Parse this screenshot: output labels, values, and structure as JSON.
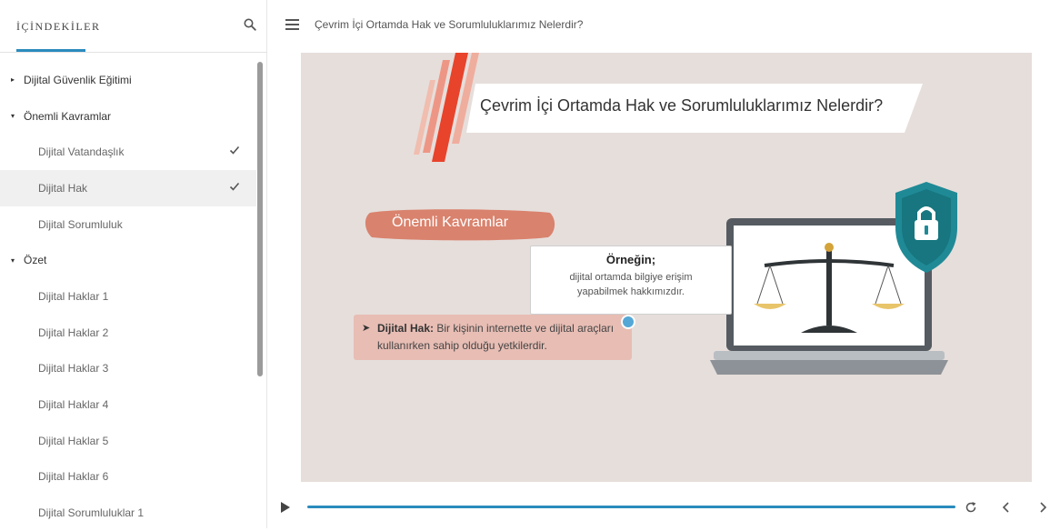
{
  "sidebar": {
    "title": "İÇİNDEKİLER",
    "search_icon": "search-icon",
    "items": [
      {
        "label": "Dijital Güvenlik Eğitimi",
        "type": "section",
        "expanded": false
      },
      {
        "label": "Önemli Kavramlar",
        "type": "section",
        "expanded": true
      },
      {
        "label": "Dijital Vatandaşlık",
        "type": "child",
        "completed": true
      },
      {
        "label": "Dijital Hak",
        "type": "child",
        "completed": true,
        "active": true
      },
      {
        "label": "Dijital Sorumluluk",
        "type": "child"
      },
      {
        "label": "Özet",
        "type": "section",
        "expanded": true
      },
      {
        "label": "Dijital Haklar 1",
        "type": "child"
      },
      {
        "label": "Dijital Haklar 2",
        "type": "child"
      },
      {
        "label": "Dijital Haklar 3",
        "type": "child"
      },
      {
        "label": "Dijital Haklar 4",
        "type": "child"
      },
      {
        "label": "Dijital Haklar 5",
        "type": "child"
      },
      {
        "label": "Dijital Haklar 6",
        "type": "child"
      },
      {
        "label": "Dijital Sorumluluklar 1",
        "type": "child"
      }
    ]
  },
  "header": {
    "title": "Çevrim İçi Ortamda Hak ve Sorumluluklarımız Nelerdir?"
  },
  "slide": {
    "banner_title": "Çevrim İçi Ortamda Hak ve Sorumluluklarımız Nelerdir?",
    "pill_label": "Önemli Kavramlar",
    "example_title": "Örneğin;",
    "example_body": "dijital ortamda bilgiye erişim yapabilmek hakkımızdır.",
    "definition_term": "Dijital Hak:",
    "definition_text": " Bir kişinin internette ve dijital araçları kullanırken sahip olduğu yetkilerdir.",
    "illustration": "laptop-scales-lock-icon"
  },
  "colors": {
    "accent": "#2a8bbd",
    "slide_bg": "#e6dedb",
    "pill": "#d9826d",
    "shield": "#1f8a96"
  },
  "player": {
    "progress": 1.0
  }
}
